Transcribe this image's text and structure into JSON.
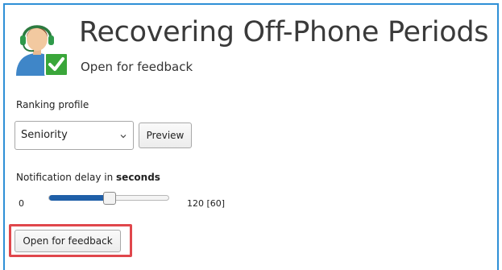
{
  "header": {
    "title": "Recovering Off-Phone Periods",
    "subtitle": "Open for feedback",
    "avatar_icon": "support-agent-check-icon"
  },
  "ranking": {
    "label": "Ranking profile",
    "selected": "Seniority",
    "preview_label": "Preview"
  },
  "delay": {
    "label_prefix": "Notification delay in ",
    "label_unit": "seconds",
    "min": "0",
    "max_display": "120 [60]",
    "value_fraction": 0.5
  },
  "actions": {
    "open_label": "Open for feedback"
  },
  "colors": {
    "frame_border": "#2f8fd6",
    "slider_fill": "#1f5fa8",
    "highlight": "#e0474c",
    "check_badge": "#3aa63a"
  }
}
